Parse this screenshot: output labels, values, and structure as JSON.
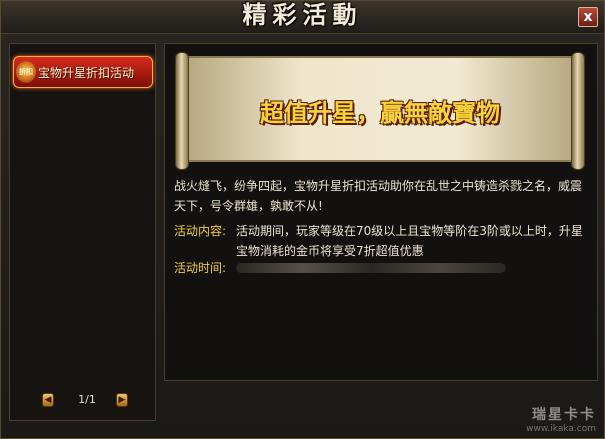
{
  "window": {
    "title": "精彩活動",
    "close_label": "x"
  },
  "sidebar": {
    "items": [
      {
        "label": "宝物升星折扣活动",
        "icon_text": "折扣",
        "icon": "flame-badge-icon",
        "selected": true
      }
    ],
    "pager": {
      "text": "1/1",
      "prev_icon": "◀",
      "next_icon": "▶"
    }
  },
  "event": {
    "banner_title": "超值升星，贏無敵寶物",
    "intro": "战火熢飞，纷争四起，宝物升星折扣活动助你在乱世之中铸造杀戮之名，威震天下，号令群雄，孰敢不从!",
    "content_label": "活动内容:",
    "content_text": "活动期间，玩家等级在70级以上且宝物等阶在3阶或以上时，升星宝物消耗的金币将享受7折超值优惠",
    "time_label": "活动时间:"
  },
  "watermark": {
    "main": "瑞星卡卡",
    "url": "www.ikaka.com"
  },
  "colors": {
    "accent_gold": "#f2cf3a",
    "selected_red": "#c6261a",
    "text": "#ece4d2"
  }
}
